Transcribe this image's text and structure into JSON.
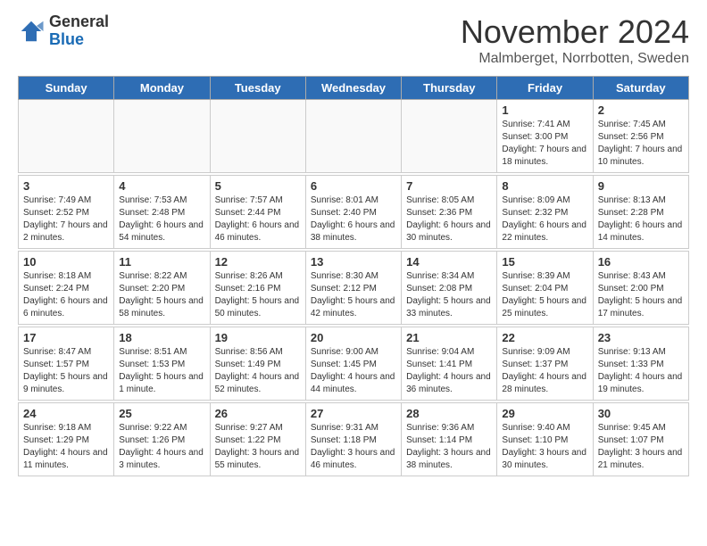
{
  "header": {
    "logo": {
      "general": "General",
      "blue": "Blue"
    },
    "title": "November 2024",
    "location": "Malmberget, Norrbotten, Sweden"
  },
  "calendar": {
    "headers": [
      "Sunday",
      "Monday",
      "Tuesday",
      "Wednesday",
      "Thursday",
      "Friday",
      "Saturday"
    ],
    "weeks": [
      [
        {
          "day": "",
          "info": ""
        },
        {
          "day": "",
          "info": ""
        },
        {
          "day": "",
          "info": ""
        },
        {
          "day": "",
          "info": ""
        },
        {
          "day": "",
          "info": ""
        },
        {
          "day": "1",
          "info": "Sunrise: 7:41 AM\nSunset: 3:00 PM\nDaylight: 7 hours and 18 minutes."
        },
        {
          "day": "2",
          "info": "Sunrise: 7:45 AM\nSunset: 2:56 PM\nDaylight: 7 hours and 10 minutes."
        }
      ],
      [
        {
          "day": "3",
          "info": "Sunrise: 7:49 AM\nSunset: 2:52 PM\nDaylight: 7 hours and 2 minutes."
        },
        {
          "day": "4",
          "info": "Sunrise: 7:53 AM\nSunset: 2:48 PM\nDaylight: 6 hours and 54 minutes."
        },
        {
          "day": "5",
          "info": "Sunrise: 7:57 AM\nSunset: 2:44 PM\nDaylight: 6 hours and 46 minutes."
        },
        {
          "day": "6",
          "info": "Sunrise: 8:01 AM\nSunset: 2:40 PM\nDaylight: 6 hours and 38 minutes."
        },
        {
          "day": "7",
          "info": "Sunrise: 8:05 AM\nSunset: 2:36 PM\nDaylight: 6 hours and 30 minutes."
        },
        {
          "day": "8",
          "info": "Sunrise: 8:09 AM\nSunset: 2:32 PM\nDaylight: 6 hours and 22 minutes."
        },
        {
          "day": "9",
          "info": "Sunrise: 8:13 AM\nSunset: 2:28 PM\nDaylight: 6 hours and 14 minutes."
        }
      ],
      [
        {
          "day": "10",
          "info": "Sunrise: 8:18 AM\nSunset: 2:24 PM\nDaylight: 6 hours and 6 minutes."
        },
        {
          "day": "11",
          "info": "Sunrise: 8:22 AM\nSunset: 2:20 PM\nDaylight: 5 hours and 58 minutes."
        },
        {
          "day": "12",
          "info": "Sunrise: 8:26 AM\nSunset: 2:16 PM\nDaylight: 5 hours and 50 minutes."
        },
        {
          "day": "13",
          "info": "Sunrise: 8:30 AM\nSunset: 2:12 PM\nDaylight: 5 hours and 42 minutes."
        },
        {
          "day": "14",
          "info": "Sunrise: 8:34 AM\nSunset: 2:08 PM\nDaylight: 5 hours and 33 minutes."
        },
        {
          "day": "15",
          "info": "Sunrise: 8:39 AM\nSunset: 2:04 PM\nDaylight: 5 hours and 25 minutes."
        },
        {
          "day": "16",
          "info": "Sunrise: 8:43 AM\nSunset: 2:00 PM\nDaylight: 5 hours and 17 minutes."
        }
      ],
      [
        {
          "day": "17",
          "info": "Sunrise: 8:47 AM\nSunset: 1:57 PM\nDaylight: 5 hours and 9 minutes."
        },
        {
          "day": "18",
          "info": "Sunrise: 8:51 AM\nSunset: 1:53 PM\nDaylight: 5 hours and 1 minute."
        },
        {
          "day": "19",
          "info": "Sunrise: 8:56 AM\nSunset: 1:49 PM\nDaylight: 4 hours and 52 minutes."
        },
        {
          "day": "20",
          "info": "Sunrise: 9:00 AM\nSunset: 1:45 PM\nDaylight: 4 hours and 44 minutes."
        },
        {
          "day": "21",
          "info": "Sunrise: 9:04 AM\nSunset: 1:41 PM\nDaylight: 4 hours and 36 minutes."
        },
        {
          "day": "22",
          "info": "Sunrise: 9:09 AM\nSunset: 1:37 PM\nDaylight: 4 hours and 28 minutes."
        },
        {
          "day": "23",
          "info": "Sunrise: 9:13 AM\nSunset: 1:33 PM\nDaylight: 4 hours and 19 minutes."
        }
      ],
      [
        {
          "day": "24",
          "info": "Sunrise: 9:18 AM\nSunset: 1:29 PM\nDaylight: 4 hours and 11 minutes."
        },
        {
          "day": "25",
          "info": "Sunrise: 9:22 AM\nSunset: 1:26 PM\nDaylight: 4 hours and 3 minutes."
        },
        {
          "day": "26",
          "info": "Sunrise: 9:27 AM\nSunset: 1:22 PM\nDaylight: 3 hours and 55 minutes."
        },
        {
          "day": "27",
          "info": "Sunrise: 9:31 AM\nSunset: 1:18 PM\nDaylight: 3 hours and 46 minutes."
        },
        {
          "day": "28",
          "info": "Sunrise: 9:36 AM\nSunset: 1:14 PM\nDaylight: 3 hours and 38 minutes."
        },
        {
          "day": "29",
          "info": "Sunrise: 9:40 AM\nSunset: 1:10 PM\nDaylight: 3 hours and 30 minutes."
        },
        {
          "day": "30",
          "info": "Sunrise: 9:45 AM\nSunset: 1:07 PM\nDaylight: 3 hours and 21 minutes."
        }
      ]
    ]
  }
}
